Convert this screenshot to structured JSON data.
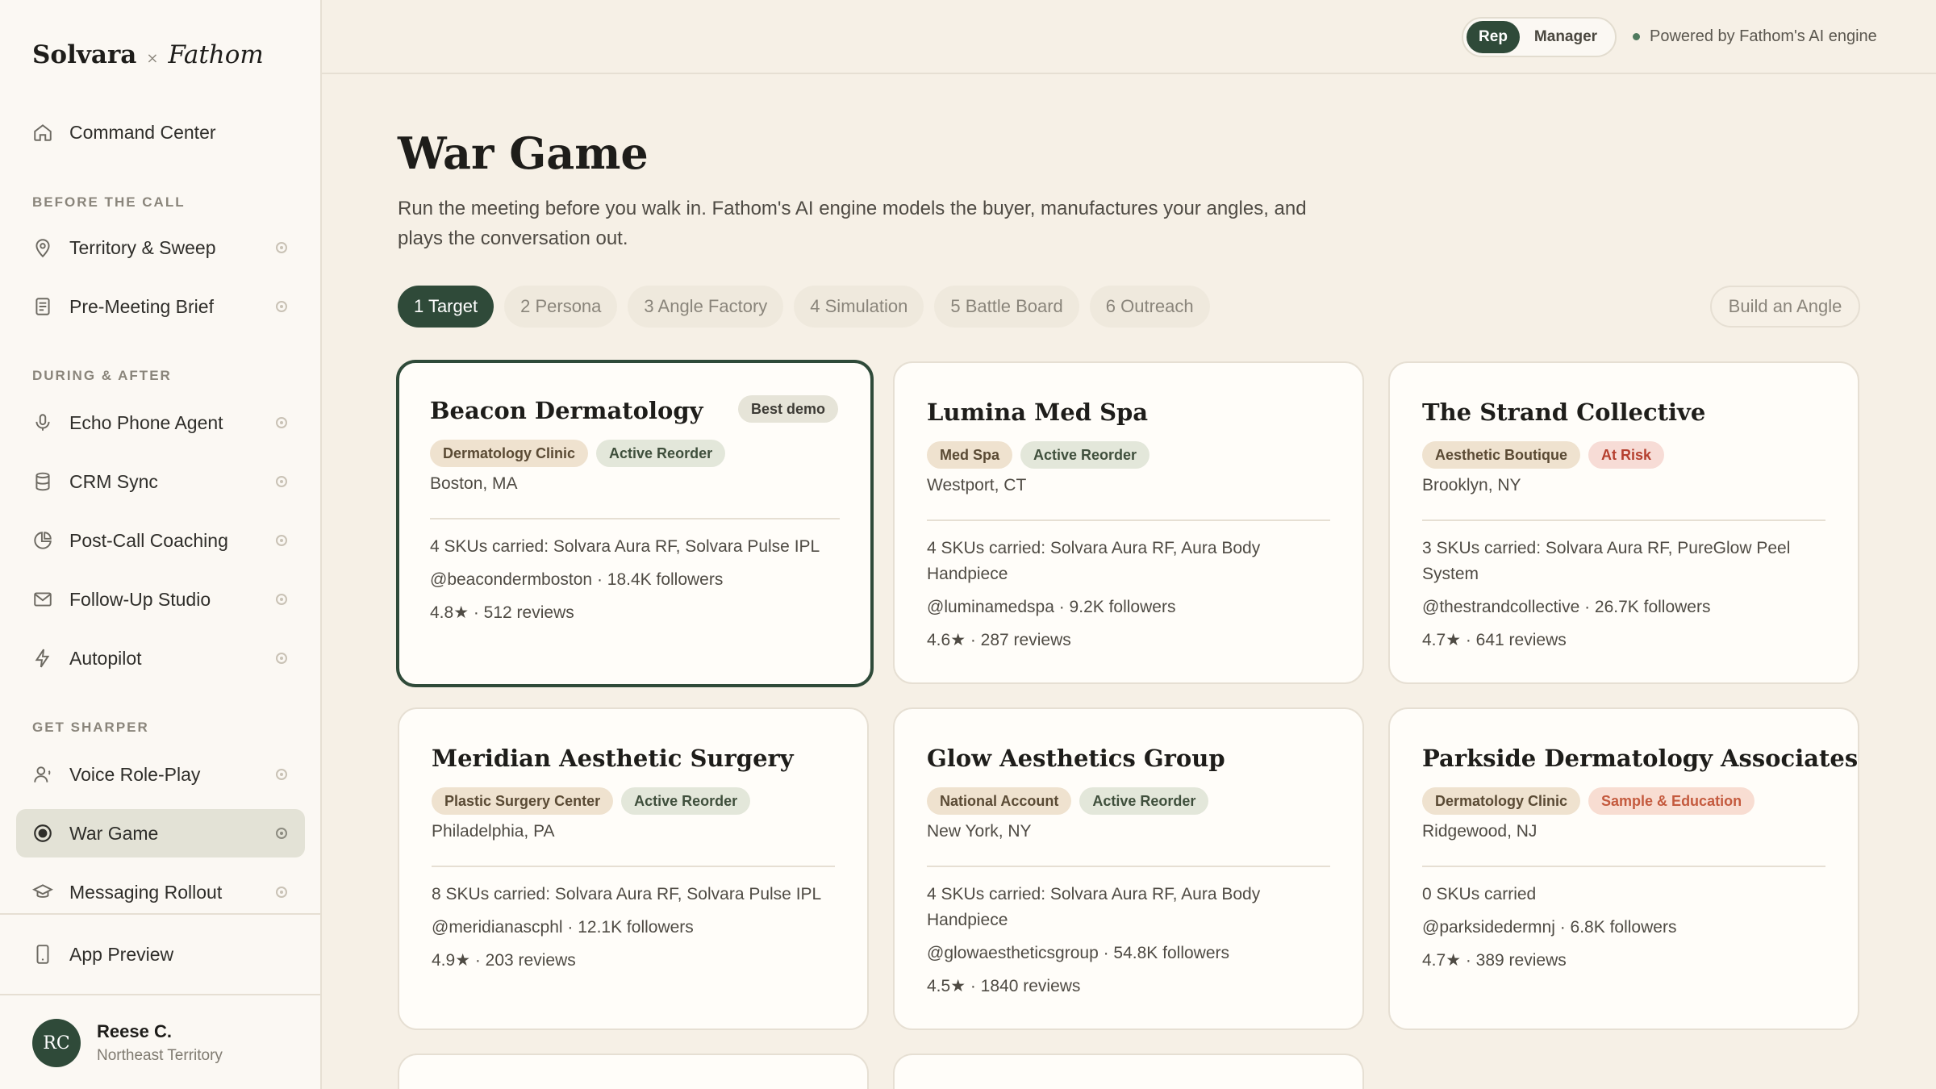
{
  "brand": {
    "name": "Solvara",
    "separator": "×",
    "partner": "Fathom"
  },
  "sidebar": {
    "top_item": {
      "label": "Command Center",
      "icon": "home-icon"
    },
    "sections": {
      "before": "BEFORE THE CALL",
      "during": "DURING & AFTER",
      "sharper": "GET SHARPER"
    },
    "items": {
      "territory": "Territory & Sweep",
      "brief": "Pre-Meeting Brief",
      "echo": "Echo Phone Agent",
      "crm": "CRM Sync",
      "coaching": "Post-Call Coaching",
      "followup": "Follow-Up Studio",
      "autopilot": "Autopilot",
      "roleplay": "Voice Role-Play",
      "wargame": "War Game",
      "rollout": "Messaging Rollout"
    },
    "app_preview": "App Preview",
    "user": {
      "initials": "RC",
      "name": "Reese C.",
      "territory": "Northeast Territory"
    }
  },
  "topbar": {
    "mode_options": [
      "Rep",
      "Manager"
    ],
    "mode_selected": "Rep",
    "powered": "Powered by Fathom's AI engine"
  },
  "main": {
    "title": "War Game",
    "subtitle": "Run the meeting before you walk in. Fathom's AI engine models the buyer, manufactures your angles, and plays the conversation out.",
    "steps": [
      "1 Target",
      "2 Persona",
      "3 Angle Factory",
      "4 Simulation",
      "5 Battle Board",
      "6 Outreach"
    ],
    "active_step": 0,
    "build_button": "Build an Angle",
    "cards": [
      {
        "name": "Beacon Dermatology",
        "badge": "Best demo",
        "type": "Dermatology Clinic",
        "status": "Active Reorder",
        "location": "Boston, MA",
        "skus": "4 SKUs carried: Solvara Aura RF, Solvara Pulse IPL",
        "social": "@beacondermboston · 18.4K followers",
        "rating": "4.8★ · 512 reviews"
      },
      {
        "name": "Lumina Med Spa",
        "type": "Med Spa",
        "status": "Active Reorder",
        "location": "Westport, CT",
        "skus": "4 SKUs carried: Solvara Aura RF, Aura Body Handpiece",
        "social": "@luminamedspa · 9.2K followers",
        "rating": "4.6★ · 287 reviews"
      },
      {
        "name": "The Strand Collective",
        "type": "Aesthetic Boutique",
        "status": "At Risk",
        "location": "Brooklyn, NY",
        "skus": "3 SKUs carried: Solvara Aura RF, PureGlow Peel System",
        "social": "@thestrandcollective · 26.7K followers",
        "rating": "4.7★ · 641 reviews"
      },
      {
        "name": "Meridian Aesthetic Surgery",
        "type": "Plastic Surgery Center",
        "status": "Active Reorder",
        "location": "Philadelphia, PA",
        "skus": "8 SKUs carried: Solvara Aura RF, Solvara Pulse IPL",
        "social": "@meridianascphl · 12.1K followers",
        "rating": "4.9★ · 203 reviews"
      },
      {
        "name": "Glow Aesthetics Group",
        "type": "National Account",
        "status": "Active Reorder",
        "location": "New York, NY",
        "skus": "4 SKUs carried: Solvara Aura RF, Aura Body Handpiece",
        "social": "@glowaestheticsgroup · 54.8K followers",
        "rating": "4.5★ · 1840 reviews"
      },
      {
        "name": "Parkside Dermatology Associates",
        "type": "Dermatology Clinic",
        "status": "Sample & Education",
        "location": "Ridgewood, NJ",
        "skus": "0 SKUs carried",
        "social": "@parksidedermnj · 6.8K followers",
        "rating": "4.7★ · 389 reviews"
      }
    ]
  }
}
